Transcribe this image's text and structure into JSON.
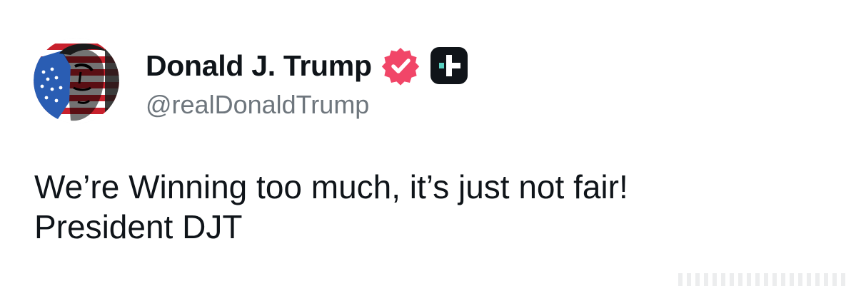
{
  "post": {
    "author": {
      "display_name": "Donald J. Trump",
      "handle": "@realDonaldTrump",
      "avatar": "flag-portrait-avatar",
      "verified_badge": "verified-badge-icon",
      "truth_plus_badge": "truth-plus-badge-icon"
    },
    "body_lines": [
      "We’re Winning too much, it’s just not fair!",
      "President DJT"
    ]
  },
  "colors": {
    "text": "#0f1419",
    "handle": "#6e767d",
    "verified": "#f14668",
    "badge_dark": "#101419",
    "badge_accent": "#5ad1c1"
  }
}
